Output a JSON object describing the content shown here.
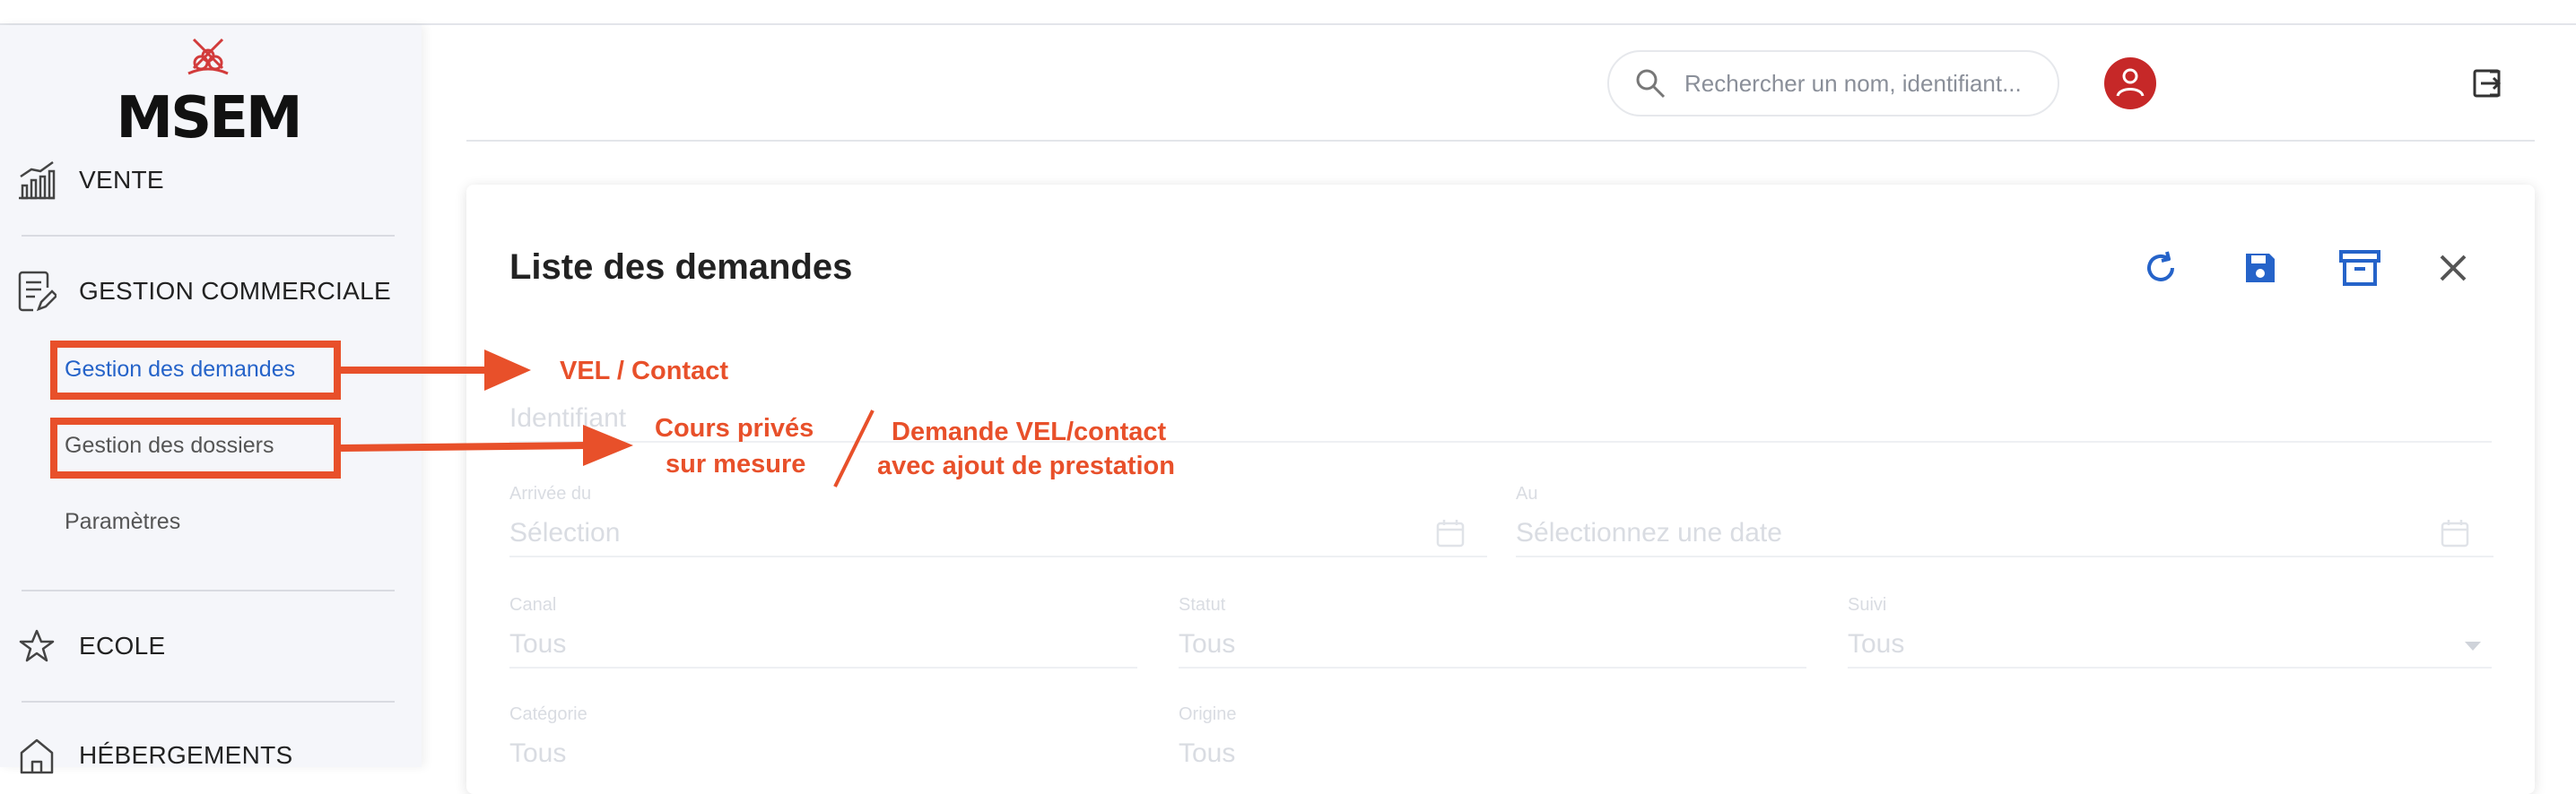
{
  "logo_text": "MSEM",
  "sidebar": {
    "sections": [
      {
        "label": "VENTE",
        "icon": "chart-icon"
      },
      {
        "label": "GESTION COMMERCIALE",
        "icon": "document-edit-icon"
      },
      {
        "label": "ECOLE",
        "icon": "star-icon"
      },
      {
        "label": "HÉBERGEMENTS",
        "icon": "home-icon"
      }
    ],
    "sub_items": [
      {
        "label": "Gestion des demandes",
        "active": true
      },
      {
        "label": "Gestion des dossiers",
        "active": false
      },
      {
        "label": "Paramètres",
        "active": false
      }
    ]
  },
  "header": {
    "search_placeholder": "Rechercher un nom, identifiant...",
    "avatar_icon": "user-icon",
    "logout_icon": "logout-icon"
  },
  "card": {
    "title": "Liste des demandes",
    "toolbar_icons": [
      "refresh-icon",
      "save-icon",
      "archive-icon",
      "close-icon"
    ],
    "filters": {
      "identifiant": "Identifiant",
      "arrivee_label": "Arrivée du",
      "arrivee_placeholder": "Sélection",
      "au_label": "Au",
      "au_placeholder": "Sélectionnez une date",
      "canal_label": "Canal",
      "canal_value": "Tous",
      "statut_label": "Statut",
      "statut_value": "Tous",
      "col3_label": "Suivi",
      "col3_value": "Tous",
      "categorie_label": "Catégorie",
      "categorie_value": "Tous",
      "col5_label": "Origine",
      "col5_value": "Tous"
    }
  },
  "annotations": {
    "color": "#e8502a",
    "vel_contact": "VEL / Contact",
    "cours_line1": "Cours privés",
    "cours_line2": "sur mesure",
    "demande_line1": "Demande VEL/contact",
    "demande_line2": "avec ajout de prestation"
  },
  "colors": {
    "accent": "#2563c9",
    "avatar": "#c62828",
    "sidebar_bg": "#f5f6fa"
  }
}
